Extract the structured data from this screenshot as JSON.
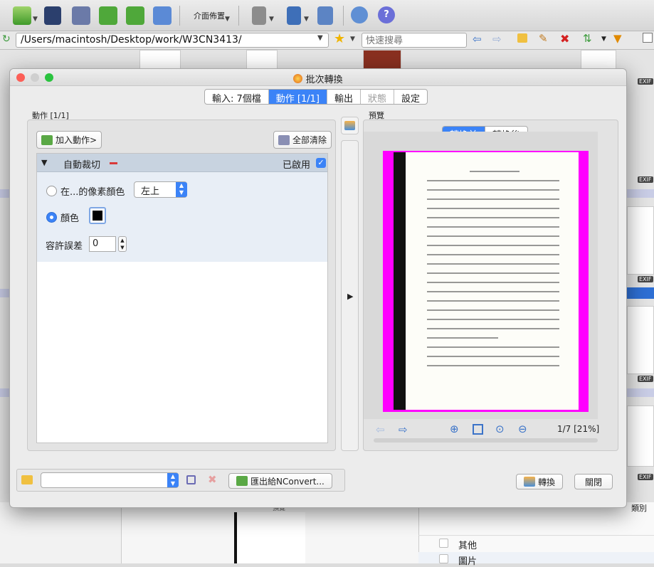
{
  "toolbar": {
    "layout_label": "介面佈置",
    "path": "/Users/macintosh/Desktop/work/W3CN3413/",
    "search_placeholder": "快速搜尋"
  },
  "dialog": {
    "title": "批次轉換",
    "tabs": [
      {
        "label": "輸入: 7個檔",
        "state": "normal"
      },
      {
        "label": "動作 [1/1]",
        "state": "active"
      },
      {
        "label": "輸出",
        "state": "normal"
      },
      {
        "label": "狀態",
        "state": "disabled"
      },
      {
        "label": "設定",
        "state": "normal"
      }
    ],
    "actions_header": "動作 [1/1]",
    "add_action_label": "加入動作>",
    "clear_all_label": "全部清除",
    "action": {
      "name": "自動裁切",
      "enabled_label": "已啟用",
      "enabled": true,
      "option_pixel_color_label": "在...的像素顏色",
      "pixel_position_value": "左上",
      "option_color_label": "顏色",
      "selected_option": "顏色",
      "color_swatch": "#000000",
      "tolerance_label": "容許誤差",
      "tolerance_value": "0"
    },
    "preview_header": "預覽",
    "preview_toggle": {
      "before": "轉換前",
      "after": "轉換後",
      "selected": "轉換前"
    },
    "preview_status": "1/7 [21%]",
    "export_label": "匯出給NConvert...",
    "convert_label": "轉換",
    "close_label": "關閉"
  },
  "background": {
    "category_header": "類別",
    "category_items": [
      "其他",
      "圖片"
    ],
    "preview_label": "預覽",
    "exif_badge": "EXIF"
  },
  "colors": {
    "accent": "#3b83f7",
    "crop_border": "#ff00ff"
  }
}
